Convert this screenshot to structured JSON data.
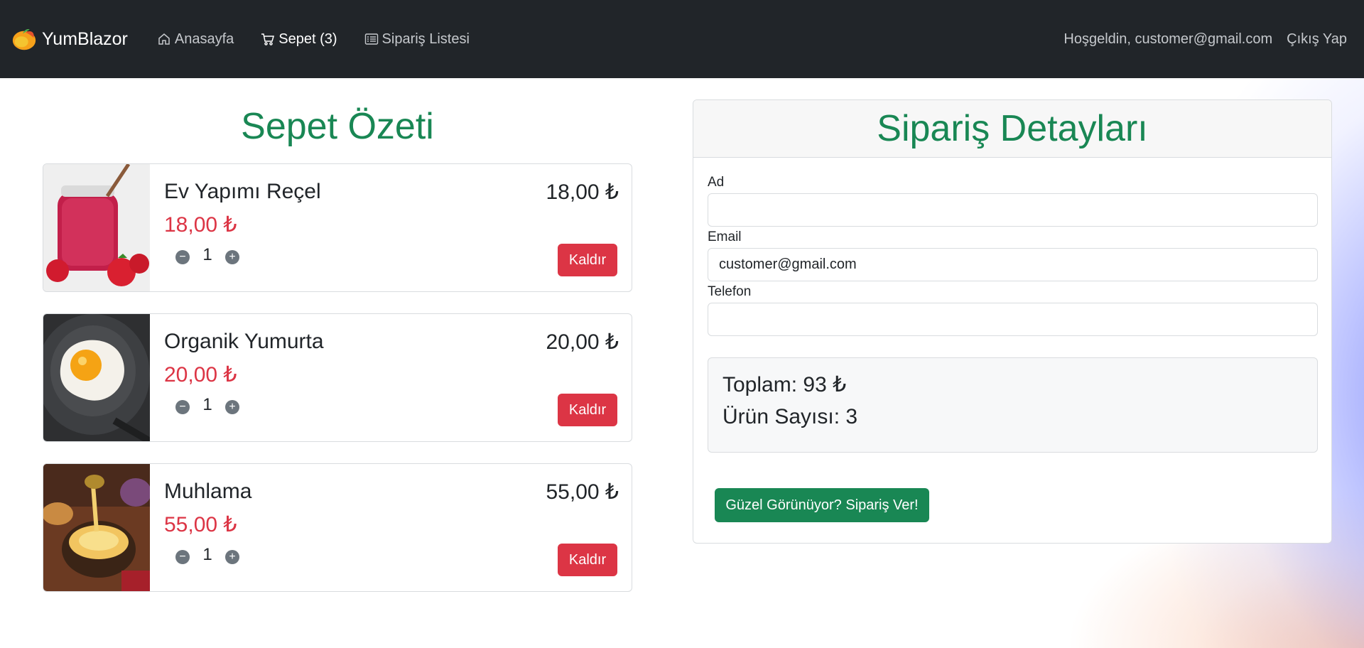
{
  "nav": {
    "brand": "YumBlazor",
    "links": [
      {
        "label": "Anasayfa",
        "icon": "house-icon"
      },
      {
        "label": "Sepet (3)",
        "icon": "cart-icon"
      },
      {
        "label": "Sipariş Listesi",
        "icon": "list-icon"
      }
    ],
    "welcome": "Hoşgeldin, customer@gmail.com",
    "logout": "Çıkış Yap"
  },
  "summary": {
    "title": "Sepet Özeti",
    "items": [
      {
        "name": "Ev Yapımı Reçel",
        "price": "18,00 ₺",
        "total": "18,00 ₺",
        "qty": "1",
        "remove": "Kaldır"
      },
      {
        "name": "Organik Yumurta",
        "price": "20,00 ₺",
        "total": "20,00 ₺",
        "qty": "1",
        "remove": "Kaldır"
      },
      {
        "name": "Muhlama",
        "price": "55,00 ₺",
        "total": "55,00 ₺",
        "qty": "1",
        "remove": "Kaldır"
      }
    ]
  },
  "order": {
    "title": "Sipariş Detayları",
    "fields": [
      {
        "label": "Ad",
        "value": ""
      },
      {
        "label": "Email",
        "value": "customer@gmail.com"
      },
      {
        "label": "Telefon",
        "value": ""
      }
    ],
    "total_line": "Toplam: 93 ₺",
    "count_line": "Ürün Sayısı: 3",
    "submit": "Güzel Görünüyor? Sipariş Ver!"
  },
  "colors": {
    "navbar": "#212529",
    "accent_green": "#198754",
    "danger_red": "#dc3545"
  }
}
